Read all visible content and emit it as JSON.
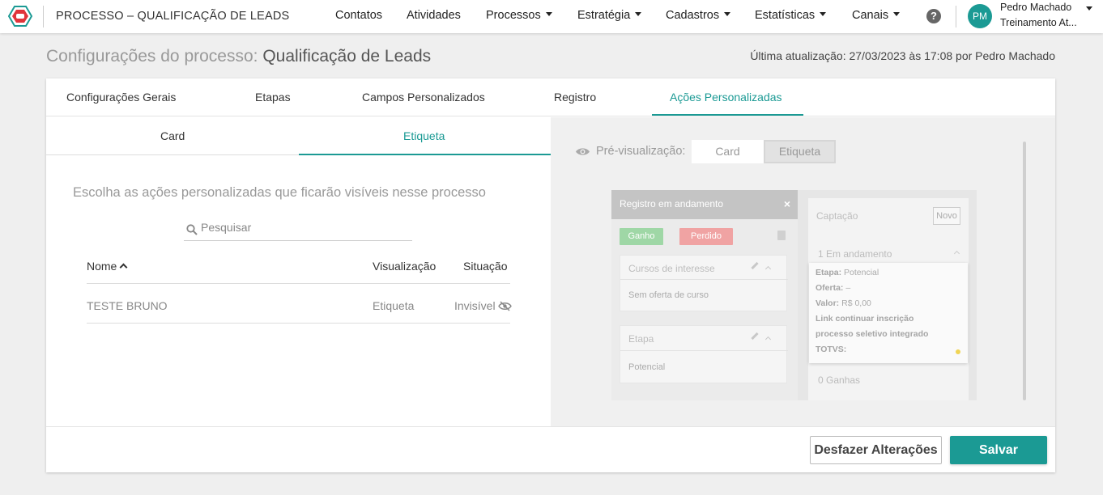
{
  "app": {
    "title": "PROCESSO – QUALIFICAÇÃO DE LEADS"
  },
  "nav": [
    {
      "label": "Contatos",
      "caret": false
    },
    {
      "label": "Atividades",
      "caret": false
    },
    {
      "label": "Processos",
      "caret": true
    },
    {
      "label": "Estratégia",
      "caret": true
    },
    {
      "label": "Cadastros",
      "caret": true
    },
    {
      "label": "Estatísticas",
      "caret": true
    },
    {
      "label": "Canais",
      "caret": true
    }
  ],
  "help": {
    "glyph": "?"
  },
  "user": {
    "initials": "PM",
    "name": "Pedro Machado",
    "subtitle": "Treinamento At..."
  },
  "header": {
    "title_prefix": "Configurações do processo:",
    "title_name": "Qualificação de Leads",
    "last_update": "Última atualização: 27/03/2023 às 17:08 por Pedro Machado"
  },
  "tabs": [
    "Configurações Gerais",
    "Etapas",
    "Campos Personalizados",
    "Registro",
    "Ações Personalizadas"
  ],
  "subtabs": [
    "Card",
    "Etiqueta"
  ],
  "left": {
    "instructions": "Escolha as ações personalizadas que ficarão visíveis nesse processo",
    "search_placeholder": "Pesquisar",
    "columns": {
      "name": "Nome",
      "view": "Visualização",
      "status": "Situação"
    },
    "rows": [
      {
        "name": "TESTE BRUNO",
        "view": "Etiqueta",
        "status": "Invisível"
      }
    ]
  },
  "preview": {
    "label": "Pré-visualização:",
    "seg_card": "Card",
    "seg_etiqueta": "Etiqueta",
    "mock": {
      "header": "Registro em andamento",
      "close": "×",
      "btn_ganho": "Ganho",
      "btn_perdido": "Perdido",
      "card1_title": "Cursos de interesse",
      "card1_value": "Sem oferta de curso",
      "card2_title": "Etapa",
      "card2_value": "Potencial",
      "column_title": "Captação",
      "new_button": "Novo",
      "group1": "1 Em andamento",
      "group2": "0 Ganhas",
      "etiqueta_lines": [
        {
          "key": "Etapa:",
          "val": "Potencial"
        },
        {
          "key": "Oferta:",
          "val": "–"
        },
        {
          "key": "Valor:",
          "val": "R$ 0,00"
        },
        {
          "key": "Link continuar inscrição",
          "val": ""
        },
        {
          "key": "processo seletivo integrado",
          "val": ""
        },
        {
          "key": "TOTVS:",
          "val": ""
        }
      ]
    }
  },
  "footer": {
    "undo": "Desfazer Alterações",
    "save": "Salvar"
  },
  "colors": {
    "accent": "#1b9a94",
    "ganho": "#9fd7a6",
    "perdido": "#f0a3a3",
    "logo": "#e0343b"
  }
}
